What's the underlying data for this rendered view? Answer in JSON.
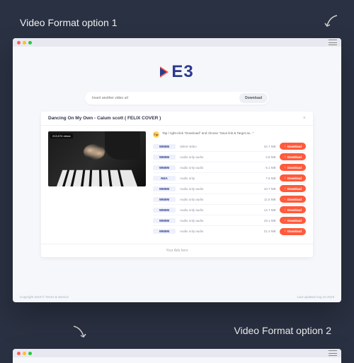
{
  "labels": {
    "option1": "Video Format option 1",
    "option2": "Video Format option 2"
  },
  "logo": {
    "text": "E3"
  },
  "search": {
    "placeholder": "Insert another video url",
    "button": "Download"
  },
  "card": {
    "title": "Dancing On My Own - Calum scott ( FELIX COVER )",
    "views": "213,074 views",
    "tip_badge": "Tip",
    "tip_text": "Tap / right-click \"Download\" and choose \"Save link & Target as...\"",
    "ad_text": "Your Ads here"
  },
  "formats": [
    {
      "fmt": "WEBM",
      "desc": "Silent Video",
      "size": "34.7 MB",
      "btn": "Download"
    },
    {
      "fmt": "WEBM",
      "desc": "Audio only audio",
      "size": "3.8 MB",
      "btn": "Download"
    },
    {
      "fmt": "WEBM",
      "desc": "Audio only audio",
      "size": "6.1 MB",
      "btn": "Download"
    },
    {
      "fmt": "M4A",
      "desc": "Audio only",
      "size": "7.6 MB",
      "btn": "Download"
    },
    {
      "fmt": "WEBM",
      "desc": "Audio only audio",
      "size": "10.7 MB",
      "btn": "Download"
    },
    {
      "fmt": "WEBM",
      "desc": "Audio only audio",
      "size": "11.5 MB",
      "btn": "Download"
    },
    {
      "fmt": "WEBM",
      "desc": "Audio only audio",
      "size": "14.7 MB",
      "btn": "Download"
    },
    {
      "fmt": "WEBM",
      "desc": "Audio only audio",
      "size": "19.1 MB",
      "btn": "Download"
    },
    {
      "fmt": "WEBM",
      "desc": "Audio only audio",
      "size": "21.4 MB",
      "btn": "Download"
    }
  ],
  "footer": {
    "left": "Copyright 2019 ©    Terms & Service",
    "right": "Last updated Aug 10 2019"
  }
}
